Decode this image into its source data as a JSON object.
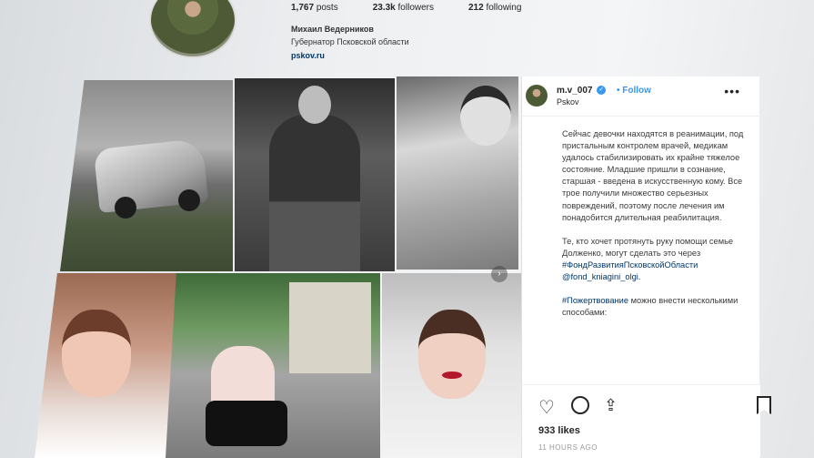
{
  "profile": {
    "posts": "1,767",
    "posts_label": "posts",
    "followers": "23.3k",
    "followers_label": "followers",
    "following": "212",
    "following_label": "following",
    "name": "Михаил Ведерников",
    "bio": "Губернатор Псковской области",
    "link": "pskov.ru"
  },
  "post": {
    "username": "m.v_007",
    "follow_label": "Follow",
    "location": "Pskov",
    "more_icon": "more-icon",
    "caption_p1": "Сейчас девочки находятся в реанимации, под пристальным контролем врачей, медикам удалось стабилизировать их крайне тяжелое состояние. Младшие пришли в сознание, старшая - введена в искусственную кому. Все трое получили множество серьезных повреждений, поэтому после лечения им понадобится длительная реабилитация.",
    "caption_p2": "Те, кто хочет протянуть руку помощи семье Долженко, могут сделать это через",
    "hashtag1": "#ФондРазвитияПсковскойОбласти",
    "mention": "@fond_kniagini_olgi.",
    "hashtag2": "#Пожертвование",
    "caption_p3": "можно внести несколькими способами:",
    "likes": "933 likes",
    "timestamp": "11 HOURS AGO"
  },
  "icons": {
    "heart": "heart-icon",
    "comment": "comment-icon",
    "share": "share-icon",
    "bookmark": "bookmark-icon",
    "verified": "verified-badge-icon",
    "carousel": "carousel-indicator-icon"
  },
  "colors": {
    "link_blue": "#3897f0",
    "hashtag_navy": "#00376b",
    "text": "#262626"
  }
}
